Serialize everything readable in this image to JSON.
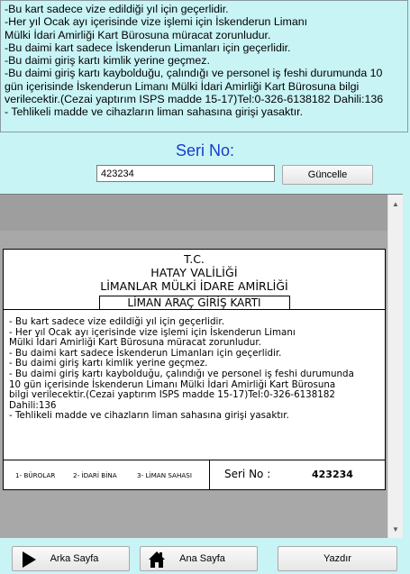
{
  "top_text": {
    "lines": [
      "-Bu kart sadece vize edildiği yıl için geçerlidir.",
      "-Her yıl Ocak ayı içerisinde vize işlemi için İskenderun Limanı",
      "Mülki İdari Amirliği Kart Bürosuna müracat zorunludur.",
      "-Bu daimi kart sadece İskenderun Limanları için geçerlidir.",
      "-Bu daimi giriş kartı kimlik yerine geçmez.",
      "-Bu daimi giriş kartı kaybolduğu, çalındığı ve personel iş feshi durumunda 10",
      "gün içerisinde İskenderun Limanı Mülki İdari Amirliği Kart Bürosuna bilgi",
      "verilecektir.(Cezai yaptırım ISPS madde 15-17)Tel:0-326-6138182 Dahili:136",
      "- Tehlikeli madde ve cihazların liman sahasına girişi yasaktır."
    ]
  },
  "serial": {
    "label": "Seri No:",
    "value": "423234",
    "update_button": "Güncelle"
  },
  "card": {
    "header": {
      "line1": "T.C.",
      "line2": "HATAY VALİLİĞİ",
      "line3": "LİMANLAR MÜLKİ İDARE AMİRLİĞİ",
      "line4": "LİMAN ARAÇ GİRİŞ KARTI"
    },
    "body_lines": [
      "- Bu kart sadece vize edildiği yıl için geçerlidir.",
      "- Her yıl Ocak ayı içerisinde vize işlemi için İskenderun Limanı",
      "Mülki İdari Amirliği Kart Bürosuna müracat zorunludur.",
      "- Bu daimi kart sadece İskenderun Limanları için geçerlidir.",
      "- Bu daimi giriş kartı kimlik yerine geçmez.",
      "- Bu daimi giriş kartı kaybolduğu, çalındığı ve personel iş feshi durumunda",
      "10 gün içerisinde İskenderun Limanı Mülki İdari Amirliği Kart Bürosuna",
      "bilgi verilecektir.(Cezai yaptırım ISPS madde 15-17)Tel:0-326-6138182",
      "Dahili:136",
      "- Tehlikeli madde ve cihazların liman sahasına girişi yasaktır."
    ],
    "footer": {
      "zone1": "1- BÜROLAR",
      "zone2": "2- İDARİ BİNA",
      "zone3": "3- LİMAN SAHASI",
      "serial_label": "Seri No :",
      "serial_value": "423234"
    }
  },
  "buttons": {
    "back": "Arka Sayfa",
    "home": "Ana Sayfa",
    "print": "Yazdır"
  },
  "icons": {
    "back": "play-arrow-icon",
    "home": "home-icon"
  },
  "colors": {
    "background": "#c8f4f6",
    "serial_label": "#1a3cc8",
    "preview_bg": "#a8a8a8"
  }
}
